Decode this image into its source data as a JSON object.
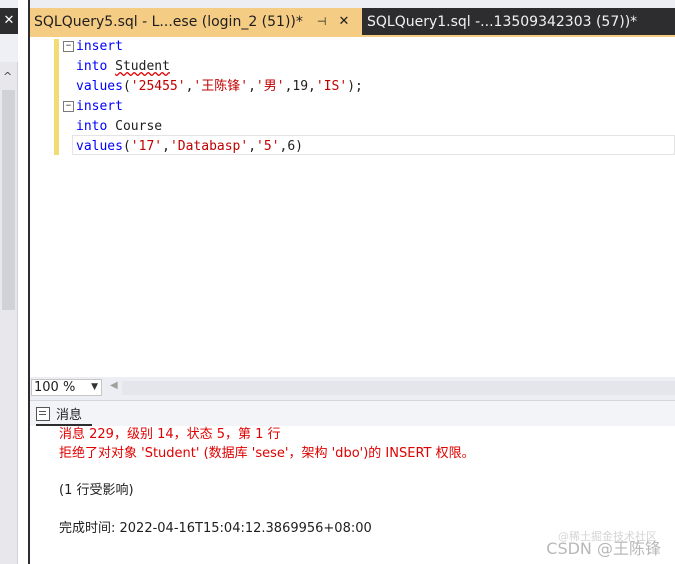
{
  "left_panel": {
    "close_glyph": "✕",
    "scroll_up_glyph": "^"
  },
  "tabs": [
    {
      "label": "SQLQuery5.sql - L...ese (login_2 (51))*",
      "pin": "⊣",
      "close": "✕",
      "active": true
    },
    {
      "label": "SQLQuery1.sql -...13509342303 (57))*",
      "active": false
    }
  ],
  "editor": {
    "fold_glyph": "−",
    "lines": [
      {
        "tokens": [
          {
            "t": "insert",
            "c": "kw"
          }
        ]
      },
      {
        "tokens": [
          {
            "t": "into",
            "c": "kw"
          },
          {
            "t": " ",
            "c": "obj"
          },
          {
            "t": "Student",
            "c": "obj squiggle"
          }
        ]
      },
      {
        "tokens": [
          {
            "t": "values",
            "c": "kw"
          },
          {
            "t": "(",
            "c": "obj"
          },
          {
            "t": "'25455'",
            "c": "str"
          },
          {
            "t": ",",
            "c": "obj"
          },
          {
            "t": "'王陈锋'",
            "c": "str"
          },
          {
            "t": ",",
            "c": "obj"
          },
          {
            "t": "'男'",
            "c": "str"
          },
          {
            "t": ",19,",
            "c": "obj"
          },
          {
            "t": "'IS'",
            "c": "str"
          },
          {
            "t": ");",
            "c": "obj"
          }
        ]
      },
      {
        "tokens": [
          {
            "t": "insert",
            "c": "kw"
          }
        ]
      },
      {
        "tokens": [
          {
            "t": "into",
            "c": "kw"
          },
          {
            "t": " Course",
            "c": "obj"
          }
        ]
      },
      {
        "tokens": [
          {
            "t": "values",
            "c": "kw"
          },
          {
            "t": "(",
            "c": "obj"
          },
          {
            "t": "'17'",
            "c": "str"
          },
          {
            "t": ",",
            "c": "obj"
          },
          {
            "t": "'Databasp'",
            "c": "str"
          },
          {
            "t": ",",
            "c": "obj"
          },
          {
            "t": "'5'",
            "c": "str"
          },
          {
            "t": ",6)",
            "c": "obj"
          }
        ]
      }
    ]
  },
  "zoom": {
    "value": "100 %",
    "arrow": "▼",
    "scroll_left": "◀"
  },
  "results": {
    "tab_label": "消息",
    "messages": [
      {
        "text": "消息 229，级别 14，状态 5，第 1 行",
        "color": "red"
      },
      {
        "text": "拒绝了对对象 'Student' (数据库 'sese'，架构 'dbo')的 INSERT 权限。",
        "color": "red"
      },
      {
        "text": "(1 行受影响)",
        "color": "black"
      },
      {
        "text": "完成时间: 2022-04-16T15:04:12.3869956+08:00",
        "color": "black"
      }
    ]
  },
  "watermark": {
    "main": "CSDN @王陈锋",
    "faint": "@稀土掘金技术社区"
  }
}
